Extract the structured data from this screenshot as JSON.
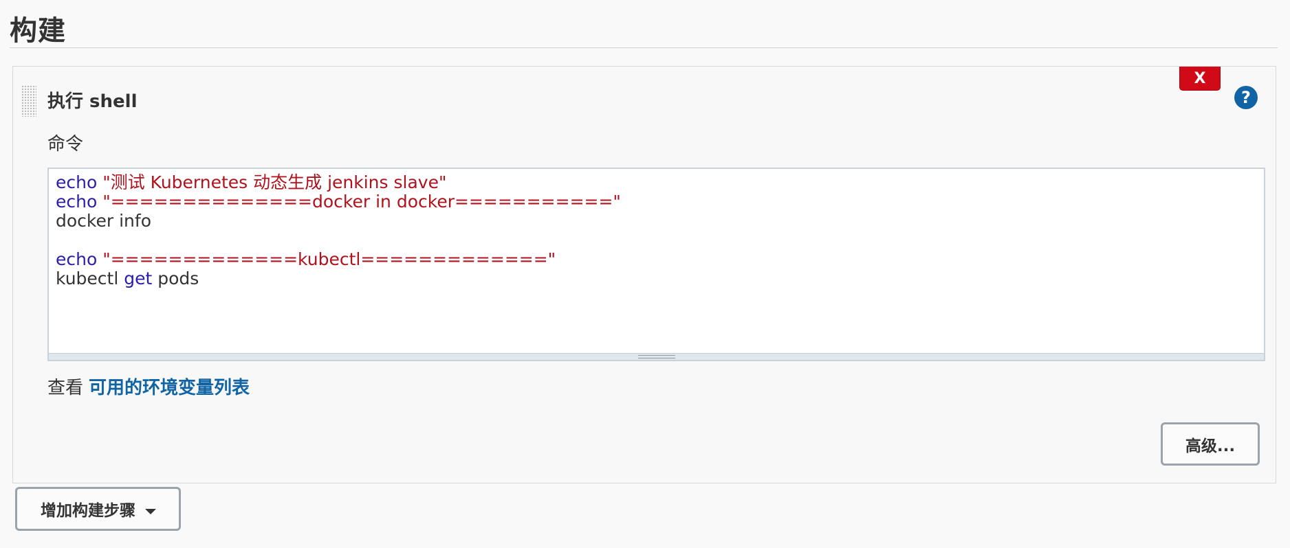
{
  "section": {
    "title": "构建"
  },
  "build_step": {
    "title": "执行 shell",
    "delete_label": "X",
    "help_label": "?",
    "command_label": "命令",
    "code_lines": [
      [
        {
          "t": "echo",
          "c": "kw"
        },
        {
          "t": " ",
          "c": "plain"
        },
        {
          "t": "\"测试 Kubernetes 动态生成 jenkins slave\"",
          "c": "str"
        }
      ],
      [
        {
          "t": "echo",
          "c": "kw"
        },
        {
          "t": " ",
          "c": "plain"
        },
        {
          "t": "\"==============docker in docker===========\"",
          "c": "str"
        }
      ],
      [
        {
          "t": "docker info",
          "c": "plain"
        }
      ],
      [],
      [
        {
          "t": "echo",
          "c": "kw"
        },
        {
          "t": " ",
          "c": "plain"
        },
        {
          "t": "\"=============kubectl=============\"",
          "c": "str"
        }
      ],
      [
        {
          "t": "kubectl ",
          "c": "plain"
        },
        {
          "t": "get",
          "c": "kw"
        },
        {
          "t": " pods",
          "c": "plain"
        }
      ]
    ],
    "env_prefix": "查看",
    "env_link": "可用的环境变量列表",
    "advanced_label": "高级..."
  },
  "add_step": {
    "label": "增加构建步骤"
  },
  "colors": {
    "keyword": "#2a1ea8",
    "string": "#b0121c",
    "link": "#1164a3",
    "delete": "#d20a17"
  }
}
